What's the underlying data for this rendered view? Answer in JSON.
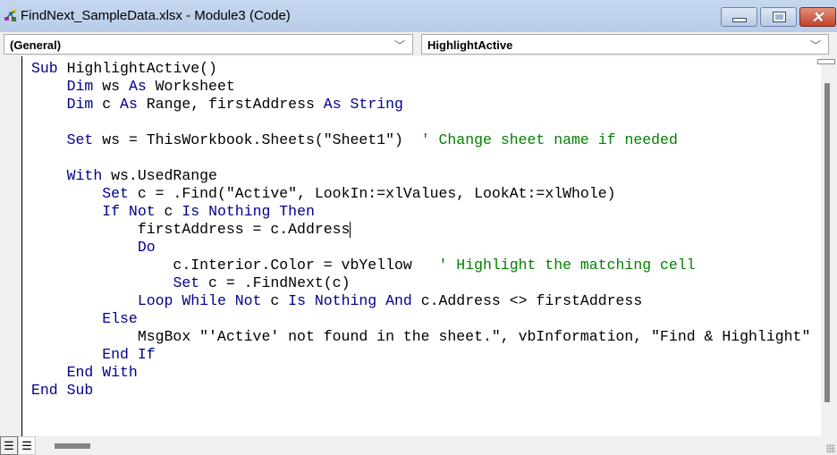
{
  "window": {
    "title": "FindNext_SampleData.xlsx - Module3 (Code)",
    "icon": "vba-project-icon",
    "buttons": {
      "minimize": "minimize-icon",
      "maximize": "maximize-icon",
      "close": "close-icon"
    }
  },
  "object_combo": {
    "value": "(General)"
  },
  "procedure_combo": {
    "value": "HighlightActive"
  },
  "colors": {
    "keyword": "#00008b",
    "comment": "#008000",
    "text": "#000000"
  },
  "code": {
    "lines": [
      [
        [
          "k",
          "Sub"
        ],
        [
          "t",
          " HighlightActive()"
        ]
      ],
      [
        [
          "t",
          "    "
        ],
        [
          "k",
          "Dim"
        ],
        [
          "t",
          " ws "
        ],
        [
          "k",
          "As"
        ],
        [
          "t",
          " Worksheet"
        ]
      ],
      [
        [
          "t",
          "    "
        ],
        [
          "k",
          "Dim"
        ],
        [
          "t",
          " c "
        ],
        [
          "k",
          "As"
        ],
        [
          "t",
          " Range, firstAddress "
        ],
        [
          "k",
          "As"
        ],
        [
          "t",
          " "
        ],
        [
          "k",
          "String"
        ]
      ],
      [],
      [
        [
          "t",
          "    "
        ],
        [
          "k",
          "Set"
        ],
        [
          "t",
          " ws = ThisWorkbook.Sheets(\"Sheet1\")  "
        ],
        [
          "c",
          "' Change sheet name if needed"
        ]
      ],
      [],
      [
        [
          "t",
          "    "
        ],
        [
          "k",
          "With"
        ],
        [
          "t",
          " ws.UsedRange"
        ]
      ],
      [
        [
          "t",
          "        "
        ],
        [
          "k",
          "Set"
        ],
        [
          "t",
          " c = .Find(\"Active\", LookIn:=xlValues, LookAt:=xlWhole)"
        ]
      ],
      [
        [
          "t",
          "        "
        ],
        [
          "k",
          "If Not"
        ],
        [
          "t",
          " c "
        ],
        [
          "k",
          "Is Nothing Then"
        ]
      ],
      [
        [
          "t",
          "            firstAddress = c.Address"
        ]
      ],
      [
        [
          "t",
          "            "
        ],
        [
          "k",
          "Do"
        ]
      ],
      [
        [
          "t",
          "                c.Interior.Color = vbYellow   "
        ],
        [
          "c",
          "' Highlight the matching cell"
        ]
      ],
      [
        [
          "t",
          "                "
        ],
        [
          "k",
          "Set"
        ],
        [
          "t",
          " c = .FindNext(c)"
        ]
      ],
      [
        [
          "t",
          "            "
        ],
        [
          "k",
          "Loop While Not"
        ],
        [
          "t",
          " c "
        ],
        [
          "k",
          "Is Nothing And"
        ],
        [
          "t",
          " c.Address <> firstAddress"
        ]
      ],
      [
        [
          "t",
          "        "
        ],
        [
          "k",
          "Else"
        ]
      ],
      [
        [
          "t",
          "            MsgBox \"'Active' not found in the sheet.\", vbInformation, \"Find & Highlight\""
        ]
      ],
      [
        [
          "t",
          "        "
        ],
        [
          "k",
          "End If"
        ]
      ],
      [
        [
          "t",
          "    "
        ],
        [
          "k",
          "End With"
        ]
      ],
      [
        [
          "k",
          "End Sub"
        ]
      ]
    ],
    "caret_line": 9
  },
  "view_buttons": {
    "procedure_view": "procedure-view-icon",
    "full_module_view": "full-module-view-icon"
  }
}
